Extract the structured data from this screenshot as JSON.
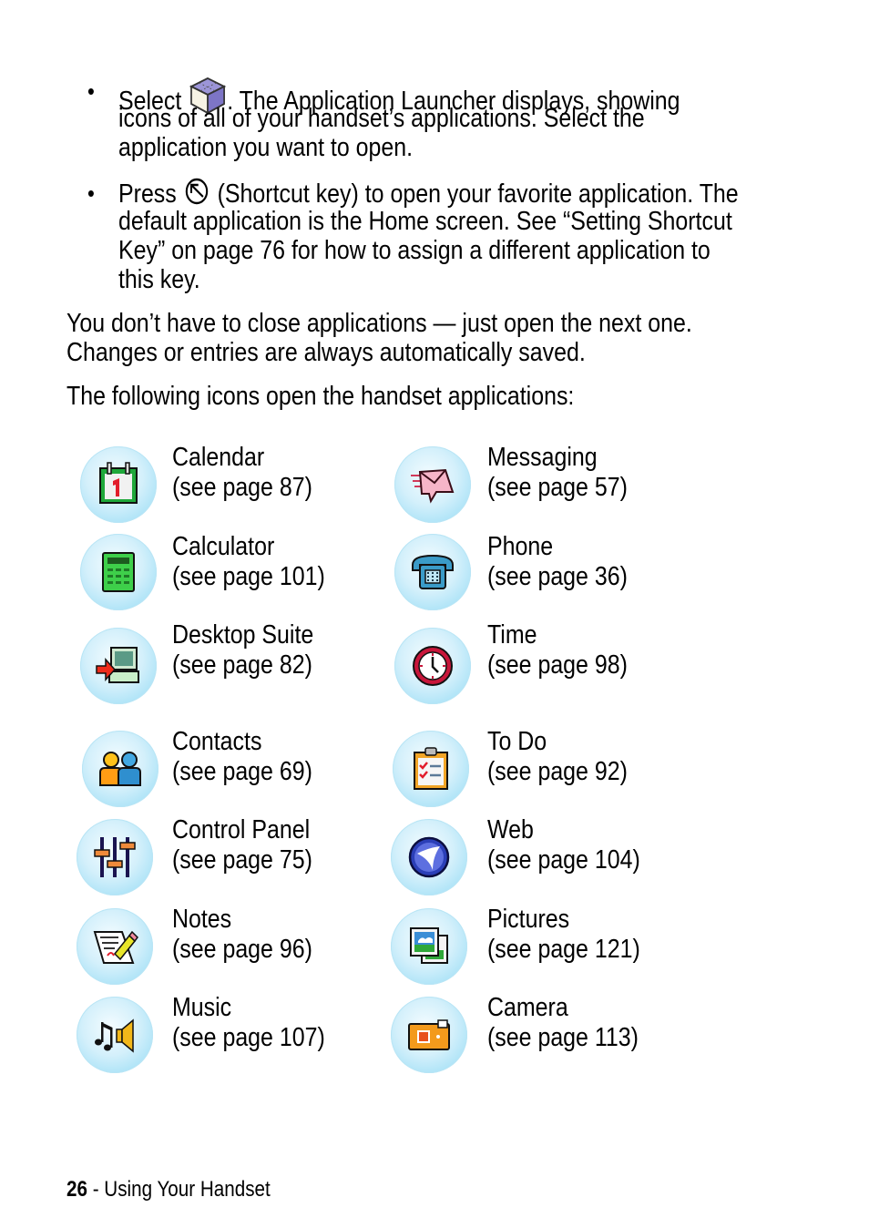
{
  "bullets": [
    {
      "lines": [
        {
          "before": "Select",
          "icon": "application-launcher-icon",
          "after": ". The Application Launcher displays, showing"
        },
        {
          "text": "icons of all of your handset’s applications. Select the"
        },
        {
          "text": "application you want to open."
        }
      ]
    },
    {
      "lines": [
        {
          "before": "Press",
          "icon": "shortcut-key-icon",
          "after": " (Shortcut key) to open your favorite application. The"
        },
        {
          "text": "default application is the Home screen. See “Setting Shortcut"
        },
        {
          "text": "Key” on page 76 for how to assign a different application to"
        },
        {
          "text": "this key."
        }
      ]
    }
  ],
  "bullet_char": "•",
  "paragraphs": [
    [
      "You don’t have to close applications — just open the next one.",
      "Changes or entries are always automatically saved."
    ],
    [
      "The following icons open the handset applications:"
    ]
  ],
  "apps": {
    "left": [
      {
        "name": "Calendar",
        "page": "(see page 87)",
        "icon": "calendar-icon"
      },
      {
        "name": "Calculator",
        "page": "(see page 101)",
        "icon": "calculator-icon"
      },
      {
        "name": "Desktop Suite",
        "page": "(see page 82)",
        "icon": "desktop-suite-icon"
      },
      {
        "name": "Contacts",
        "page": "(see page 69)",
        "icon": "contacts-icon"
      },
      {
        "name": "Control Panel",
        "page": "(see page 75)",
        "icon": "control-panel-icon"
      },
      {
        "name": "Notes",
        "page": "(see page 96)",
        "icon": "notes-icon"
      },
      {
        "name": "Music",
        "page": "(see page 107)",
        "icon": "music-icon"
      }
    ],
    "right": [
      {
        "name": "Messaging",
        "page": "(see page 57)",
        "icon": "messaging-icon"
      },
      {
        "name": "Phone",
        "page": "(see page 36)",
        "icon": "phone-icon"
      },
      {
        "name": "Time",
        "page": "(see page 98)",
        "icon": "time-icon"
      },
      {
        "name": "To Do",
        "page": "(see page 92)",
        "icon": "todo-icon"
      },
      {
        "name": "Web",
        "page": "(see page 104)",
        "icon": "web-icon"
      },
      {
        "name": "Pictures",
        "page": "(see page 121)",
        "icon": "pictures-icon"
      },
      {
        "name": "Camera",
        "page": "(see page 113)",
        "icon": "camera-icon"
      }
    ]
  },
  "footer": {
    "page_number": "26",
    "separator": " - ",
    "section": "Using Your Handset"
  }
}
